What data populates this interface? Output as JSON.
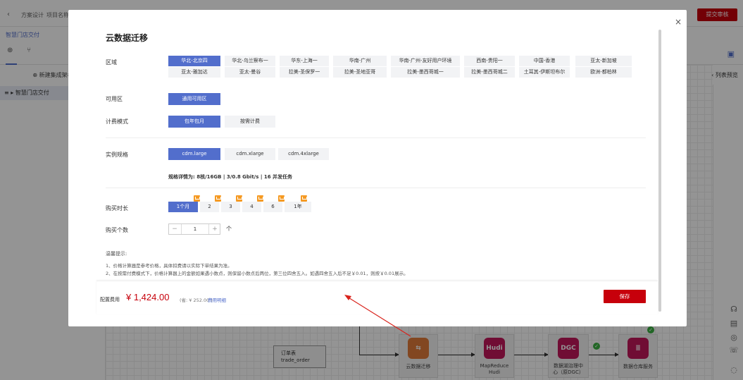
{
  "background": {
    "crumbs": [
      "方案设计",
      "项目名称"
    ],
    "submit_label": "提交审核",
    "project_name": "智慧门店交付",
    "new_arch_label": "新建集成架构",
    "tree_item": "智慧门店交付",
    "list_preview_label": "列表预览",
    "order_table": {
      "line1": "订单表",
      "line2": "trade_order"
    },
    "flow_nodes": [
      {
        "label": "云数据迁移",
        "icon_text": ""
      },
      {
        "label1": "MapReduce",
        "label2": "Hudi",
        "icon_text": "Hudi"
      },
      {
        "label1": "数据湖治理中",
        "label2": "心（原DGC）",
        "icon_text": "DGC"
      },
      {
        "label": "数据仓库服务",
        "icon_text": ""
      }
    ]
  },
  "modal": {
    "title": "云数据迁移",
    "region_label": "区域",
    "regions_row1": [
      "华北-北京四",
      "华北-乌兰察布一",
      "华东-上海一",
      "华南-广州",
      "华南-广州-友好用户环境",
      "西南-贵阳一",
      "中国-香港",
      "亚太-新加坡"
    ],
    "regions_row2": [
      "亚太-雅加达",
      "亚太-曼谷",
      "拉美-圣保罗一",
      "拉美-圣地亚哥",
      "拉美-墨西哥城一",
      "拉美-墨西哥城二",
      "土耳其-伊斯坦布尔",
      "欧洲-都柏林"
    ],
    "selected_region": "华北-北京四",
    "az_label": "可用区",
    "az_option": "通用可用区",
    "billing_label": "计费模式",
    "billing_options": [
      "包年包月",
      "按需计费"
    ],
    "spec_label": "实例规格",
    "spec_options": [
      "cdm.large",
      "cdm.xlarge",
      "cdm.4xlarge"
    ],
    "spec_detail": "规格详情为:  8核/16GB | 3/0.8 Gbit/s | 16 并发任务",
    "duration_label": "购买时长",
    "duration_options": [
      "1个月",
      "2",
      "3",
      "4",
      "6",
      "1年"
    ],
    "quantity_label": "购买个数",
    "quantity_minus": "−",
    "quantity_value": "1",
    "quantity_plus": "+",
    "quantity_unit": "个",
    "tips_title": "温馨提示:",
    "tips": [
      "1、价格计算器是参考价格，具体扣费请以实际下单结果为准。",
      "2、在按需付费模式下，价格计算器上的金额如果遇小数点，则保留小数点后两位，第三位四舍五入。如遇四舍五入后不足￥0.01，则按￥0.01展示。"
    ],
    "fee_label": "配置费用",
    "fee_price": "¥ 1,424.00",
    "fee_save": "(省: ¥ 252.00 )",
    "fee_detail": "费用明细",
    "save_label": "保存",
    "close": "×"
  },
  "colors": {
    "accent": "#526ecc",
    "brand_red": "#c7000b",
    "tag_orange": "#f59a23"
  }
}
